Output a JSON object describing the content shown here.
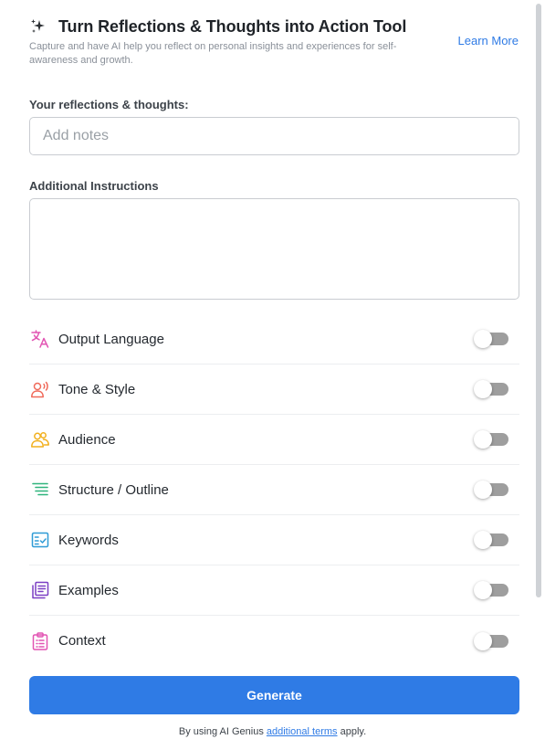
{
  "header": {
    "title": "Turn Reflections & Thoughts into Action Tool",
    "subtitle": "Capture and have AI help you reflect on personal insights and experiences for self-awareness and growth.",
    "learn_more": "Learn More"
  },
  "form": {
    "reflections_label": "Your reflections & thoughts:",
    "reflections_placeholder": "Add notes",
    "reflections_value": "",
    "instructions_label": "Additional Instructions",
    "instructions_value": ""
  },
  "options": [
    {
      "label": "Output Language",
      "icon": "translate-icon",
      "color": "#e255b3",
      "enabled": false
    },
    {
      "label": "Tone & Style",
      "icon": "speaking-person-icon",
      "color": "#f06a5a",
      "enabled": false
    },
    {
      "label": "Audience",
      "icon": "people-icon",
      "color": "#f2b01e",
      "enabled": false
    },
    {
      "label": "Structure / Outline",
      "icon": "outline-list-icon",
      "color": "#2fb47c",
      "enabled": false
    },
    {
      "label": "Keywords",
      "icon": "checklist-icon",
      "color": "#2f9bd6",
      "enabled": false
    },
    {
      "label": "Examples",
      "icon": "documents-icon",
      "color": "#7b3fc4",
      "enabled": false
    },
    {
      "label": "Context",
      "icon": "clipboard-icon",
      "color": "#e255b3",
      "enabled": false
    }
  ],
  "actions": {
    "generate_label": "Generate"
  },
  "footer": {
    "prefix": "By using AI Genius ",
    "link": "additional terms",
    "suffix": " apply."
  },
  "colors": {
    "accent": "#2f7be5",
    "toggle_off": "#9e9e9e"
  }
}
